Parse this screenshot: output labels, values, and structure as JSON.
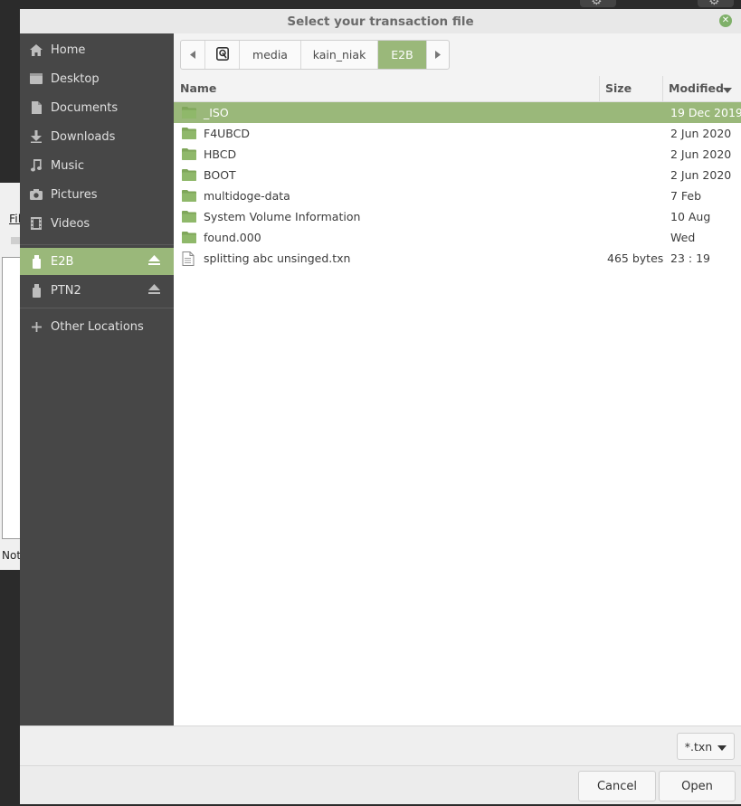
{
  "background": {
    "menu_fragment": "Fil",
    "status_fragment": "Not"
  },
  "dialog": {
    "title": "Select your transaction file"
  },
  "sidebar": {
    "items": [
      {
        "label": "Home",
        "icon": "home-icon"
      },
      {
        "label": "Desktop",
        "icon": "desktop-icon"
      },
      {
        "label": "Documents",
        "icon": "documents-icon"
      },
      {
        "label": "Downloads",
        "icon": "downloads-icon"
      },
      {
        "label": "Music",
        "icon": "music-icon"
      },
      {
        "label": "Pictures",
        "icon": "pictures-icon"
      },
      {
        "label": "Videos",
        "icon": "videos-icon"
      }
    ],
    "devices": [
      {
        "label": "E2B",
        "icon": "usb-drive-icon",
        "active": true
      },
      {
        "label": "PTN2",
        "icon": "usb-drive-icon",
        "active": false
      }
    ],
    "other_locations": "Other Locations"
  },
  "pathbar": {
    "crumbs": [
      "media",
      "kain_niak",
      "E2B"
    ]
  },
  "columns": {
    "name": "Name",
    "size": "Size",
    "modified": "Modified"
  },
  "files": [
    {
      "name": "_ISO",
      "type": "folder",
      "size": "",
      "modified": "19 Dec 2019",
      "selected": true
    },
    {
      "name": "F4UBCD",
      "type": "folder",
      "size": "",
      "modified": "2 Jun 2020"
    },
    {
      "name": "HBCD",
      "type": "folder",
      "size": "",
      "modified": "2 Jun 2020"
    },
    {
      "name": "BOOT",
      "type": "folder",
      "size": "",
      "modified": "2 Jun 2020"
    },
    {
      "name": "multidoge-data",
      "type": "folder",
      "size": "",
      "modified": "7 Feb"
    },
    {
      "name": "System Volume Information",
      "type": "folder",
      "size": "",
      "modified": "10 Aug"
    },
    {
      "name": "found.000",
      "type": "folder",
      "size": "",
      "modified": "Wed"
    },
    {
      "name": "splitting abc unsinged.txn",
      "type": "file",
      "size": "465 bytes",
      "modified": "23 : 19"
    }
  ],
  "filter": {
    "selected": "*.txn"
  },
  "buttons": {
    "cancel": "Cancel",
    "open": "Open"
  },
  "colors": {
    "accent": "#9ab87a",
    "sidebar": "#474747",
    "folder": "#7fa65a"
  }
}
